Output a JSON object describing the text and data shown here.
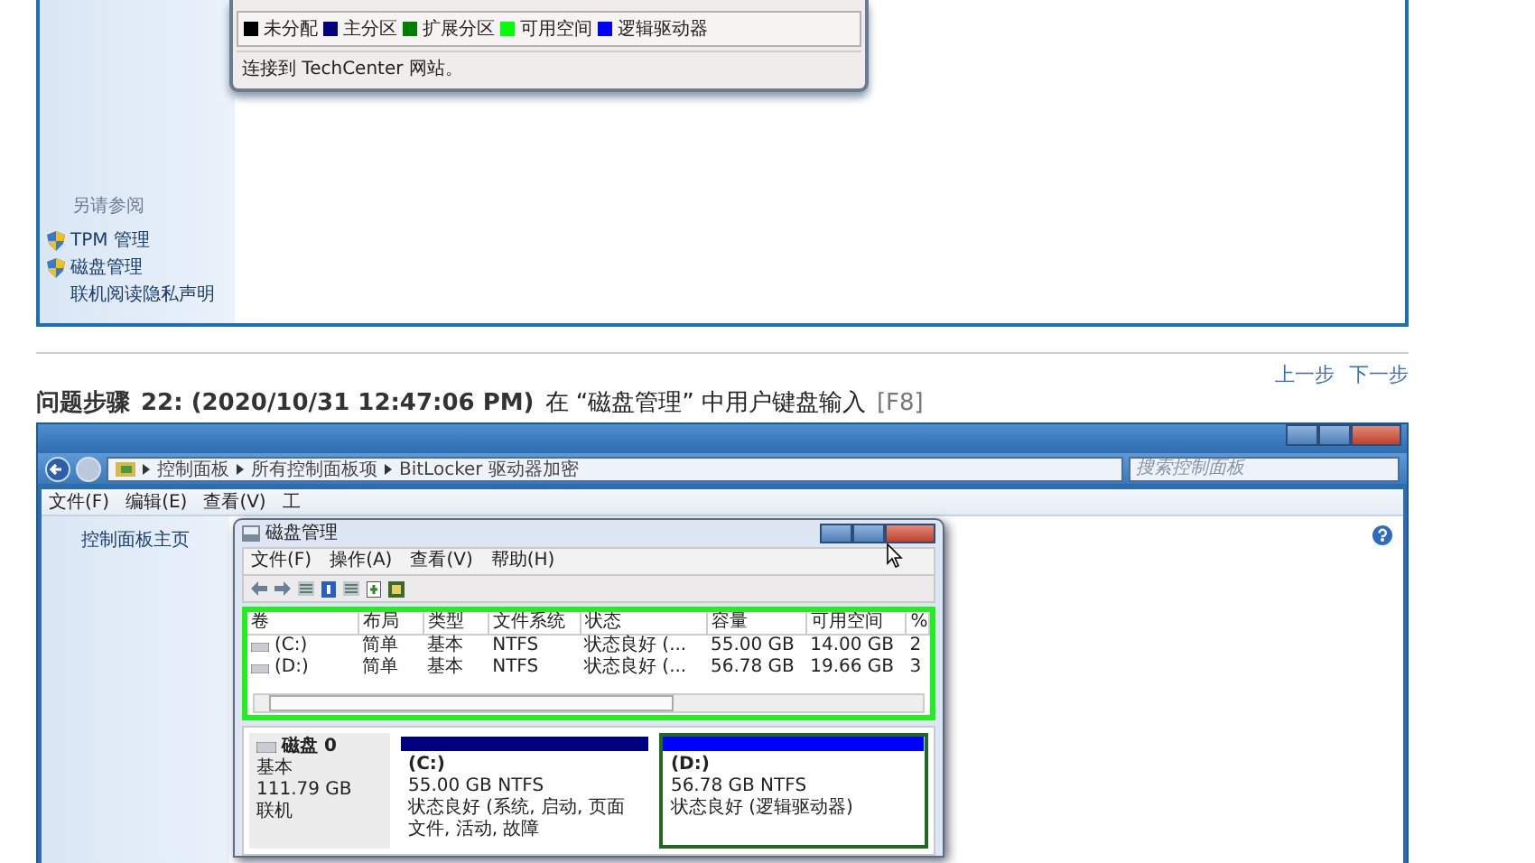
{
  "top_capture": {
    "legend": [
      {
        "label": "未分配",
        "color": "#000000"
      },
      {
        "label": "主分区",
        "color": "#000080"
      },
      {
        "label": "扩展分区",
        "color": "#008000"
      },
      {
        "label": "可用空间",
        "color": "#00ff00"
      },
      {
        "label": "逻辑驱动器",
        "color": "#0000ff"
      }
    ],
    "status_bar": "连接到 TechCenter 网站。",
    "see_also": {
      "heading": "另请参阅",
      "items": [
        {
          "label": "TPM 管理",
          "shield": true
        },
        {
          "label": "磁盘管理",
          "shield": true
        },
        {
          "label": "联机阅读隐私声明",
          "shield": false
        }
      ]
    }
  },
  "nav_links": [
    "上一步",
    "下一步"
  ],
  "step": {
    "label": "问题步骤",
    "number": "22: (2020/10/31 12:47:06 PM)",
    "description": "在 “磁盘管理” 中用户键盘输入",
    "key": "[F8]"
  },
  "bottom_capture": {
    "breadcrumb": [
      "控制面板",
      "所有控制面板项",
      "BitLocker 驱动器加密"
    ],
    "search": {
      "placeholder": "搜索控制面板"
    },
    "menu": [
      "文件(F)",
      "编辑(E)",
      "查看(V)",
      "工"
    ],
    "sidebar_link": "控制面板主页",
    "dm_window": {
      "title": "磁盘管理",
      "menu": [
        "文件(F)",
        "操作(A)",
        "查看(V)",
        "帮助(H)"
      ],
      "columns": [
        "卷",
        "布局",
        "类型",
        "文件系统",
        "状态",
        "容量",
        "可用空间",
        "%"
      ],
      "rows": [
        [
          "(C:)",
          "简单",
          "基本",
          "NTFS",
          "状态良好 (...",
          "55.00 GB",
          "14.00 GB",
          "2"
        ],
        [
          "(D:)",
          "简单",
          "基本",
          "NTFS",
          "状态良好 (...",
          "56.78 GB",
          "19.66 GB",
          "3"
        ]
      ],
      "disk": {
        "name": "磁盘 0",
        "type": "基本",
        "size": "111.79 GB",
        "status": "联机"
      },
      "partitions": [
        {
          "label": "(C:)",
          "size": "55.00 GB NTFS",
          "status": "状态良好 (系统, 启动, 页面文件, 活动, 故障",
          "color": "#000080",
          "selected": false
        },
        {
          "label": "(D:)",
          "size": "56.78 GB NTFS",
          "status": "状态良好 (逻辑驱动器)",
          "color": "#0000ff",
          "selected": true
        }
      ]
    }
  }
}
